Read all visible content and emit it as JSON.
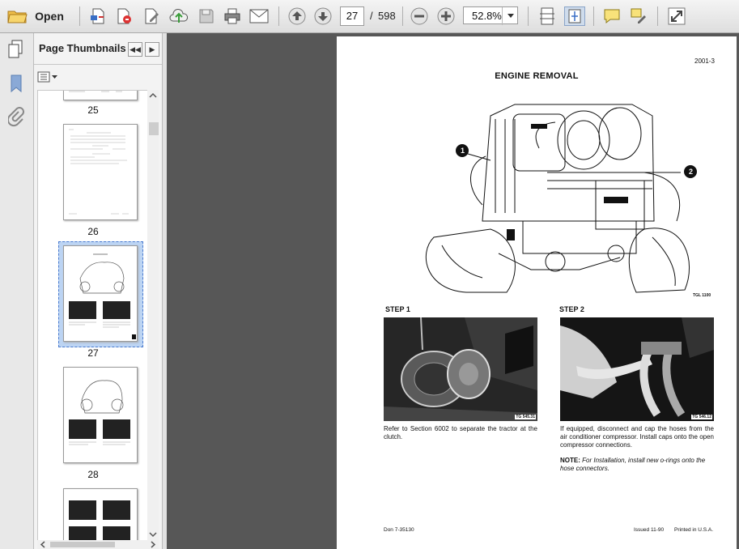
{
  "toolbar": {
    "open_label": "Open",
    "current_page": "27",
    "page_separator": "/",
    "total_pages": "598",
    "zoom": "52.8%",
    "icons": [
      "open-folder-icon",
      "create-pdf-icon",
      "convert-pdf-icon",
      "edit-pdf-icon",
      "upload-cloud-icon",
      "save-icon",
      "print-icon",
      "email-icon",
      "page-up-icon",
      "page-down-icon",
      "zoom-out-icon",
      "zoom-in-icon",
      "fit-page-icon",
      "fit-width-icon",
      "comment-icon",
      "highlight-icon",
      "fullscreen-icon"
    ]
  },
  "sidebar": {
    "title": "Page Thumbnails",
    "thumbnails": [
      {
        "label": "25"
      },
      {
        "label": "26"
      },
      {
        "label": "27",
        "selected": true
      },
      {
        "label": "28"
      },
      {
        "label": ""
      }
    ]
  },
  "document": {
    "page_code": "2001-3",
    "title": "ENGINE REMOVAL",
    "callout_1": "1",
    "callout_2": "2",
    "figure_tag": "TGL 1100",
    "step1": {
      "heading": "STEP 1",
      "photo_tag": "TG 545.31",
      "text": "Refer to Section 6002 to separate the tractor at the clutch."
    },
    "step2": {
      "heading": "STEP 2",
      "photo_tag": "TG 546.12",
      "text": "If equipped, disconnect and cap the hoses from the air conditioner compressor. Install caps onto the open compressor connections.",
      "note_label": "NOTE:",
      "note_text": "For Installation, install new o-rings onto the hose connectors."
    },
    "footer_left": "Don 7-35130",
    "footer_issued": "Issued 11-90",
    "footer_printed": "Printed in U.S.A."
  }
}
